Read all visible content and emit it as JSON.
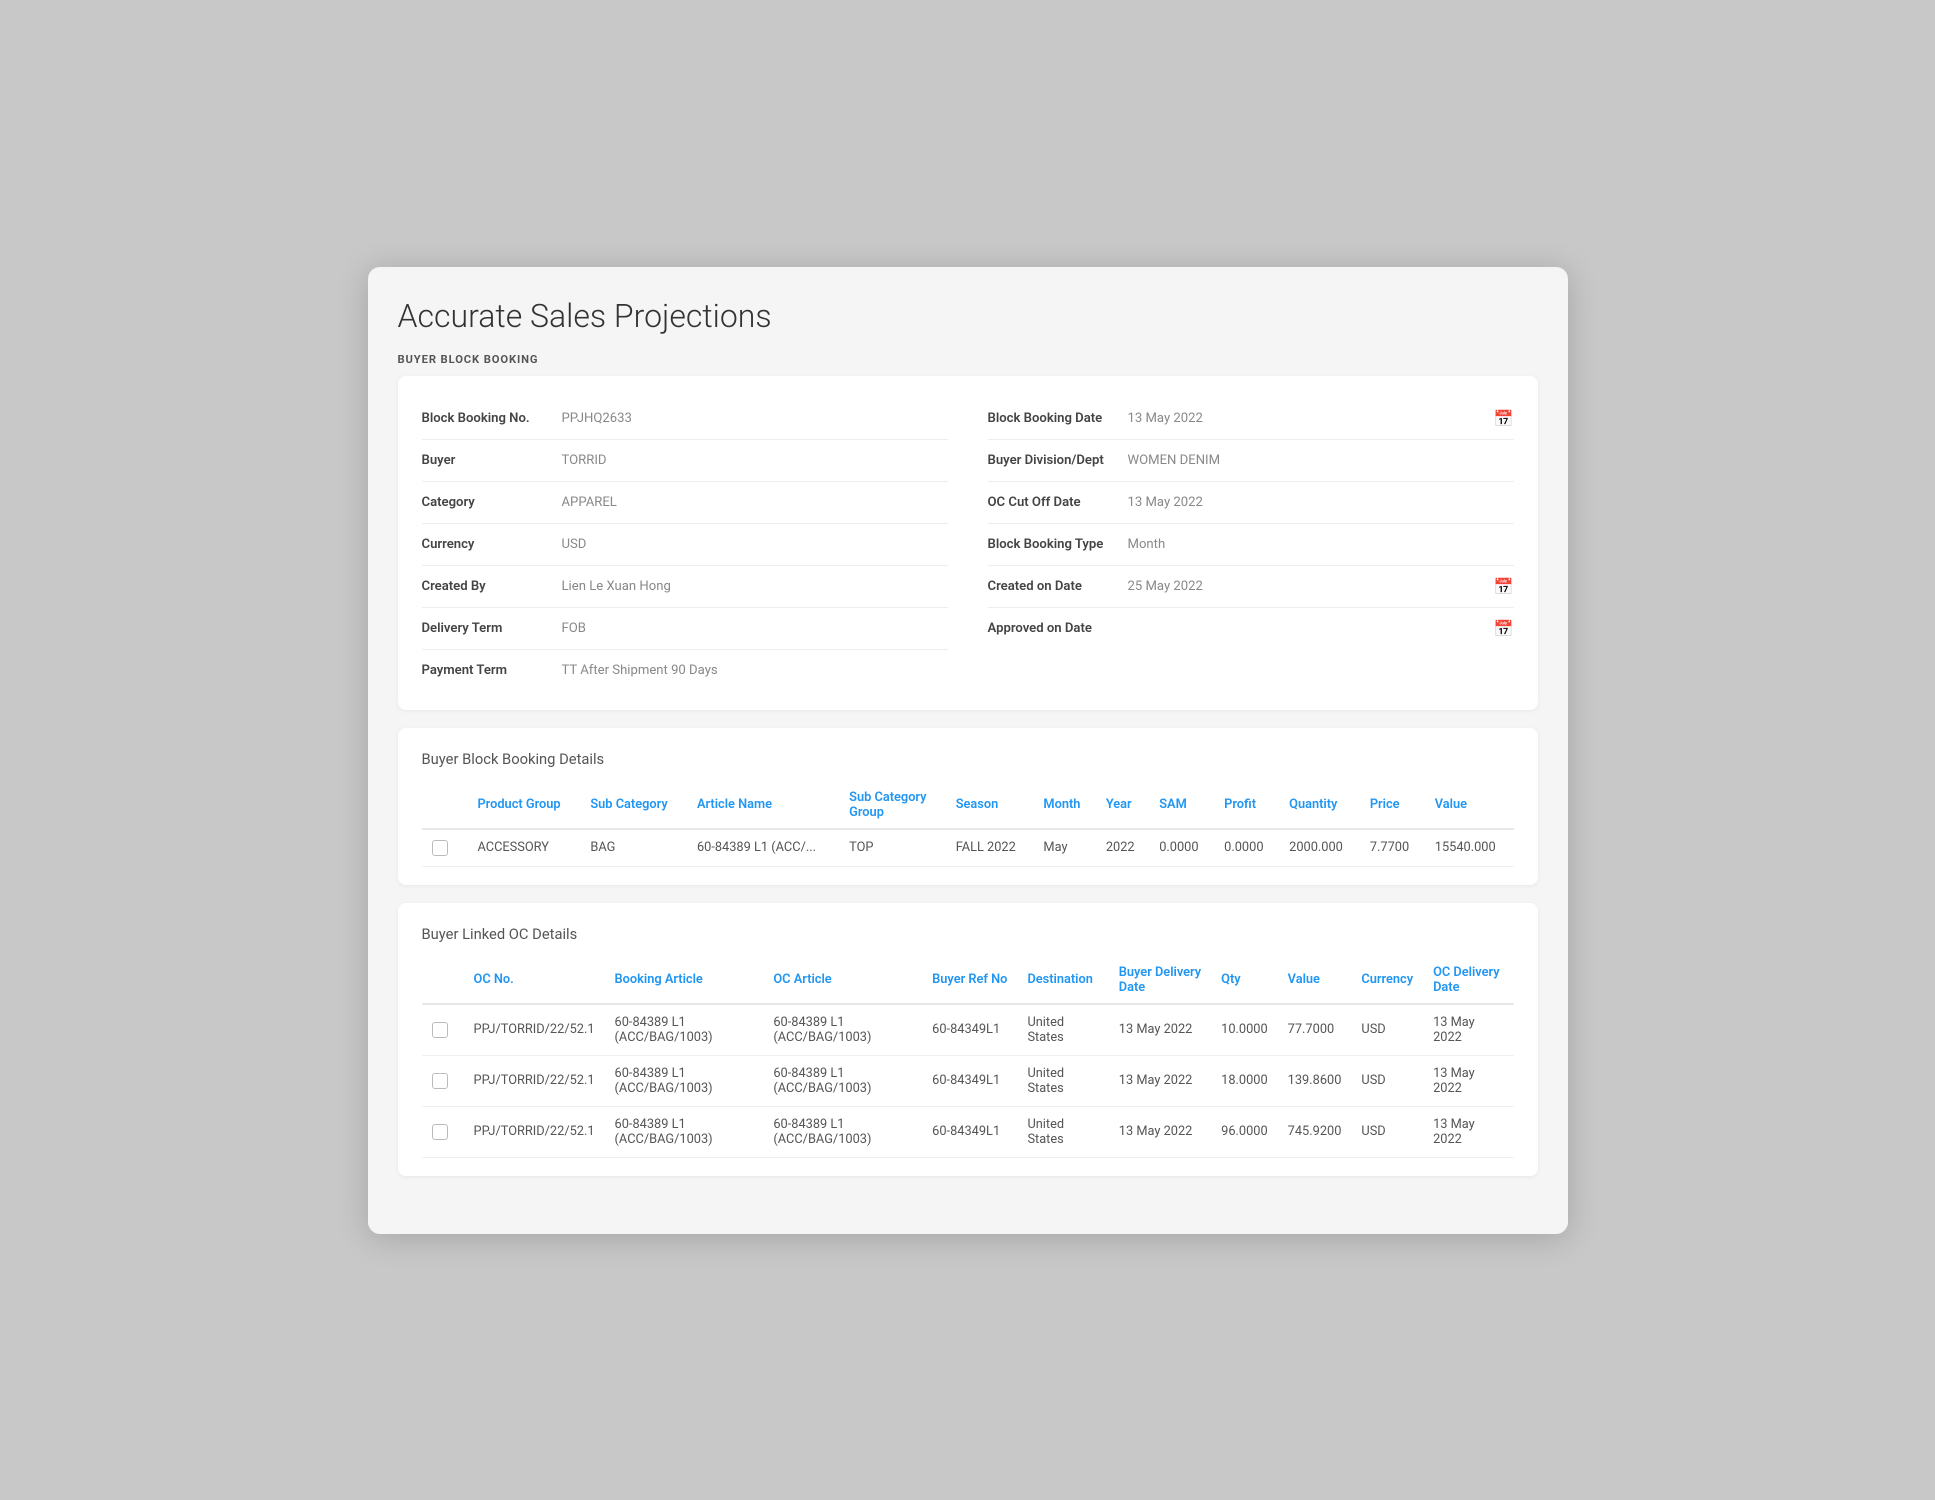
{
  "page": {
    "title": "Accurate Sales Projections",
    "section_label": "BUYER BLOCK BOOKING"
  },
  "form": {
    "left": [
      {
        "label": "Block Booking No.",
        "value": "PPJHQ2633"
      },
      {
        "label": "Buyer",
        "value": "TORRID"
      },
      {
        "label": "Category",
        "value": "APPAREL"
      },
      {
        "label": "Currency",
        "value": "USD"
      },
      {
        "label": "Created By",
        "value": "Lien Le Xuan Hong"
      },
      {
        "label": "Delivery Term",
        "value": "FOB"
      },
      {
        "label": "Payment Term",
        "value": "TT After Shipment 90 Days"
      }
    ],
    "right": [
      {
        "label": "Block Booking Date",
        "value": "13 May 2022",
        "has_icon": true
      },
      {
        "label": "Buyer Division/Dept",
        "value": "WOMEN DENIM",
        "has_icon": false
      },
      {
        "label": "OC Cut Off Date",
        "value": "13 May 2022",
        "has_icon": false
      },
      {
        "label": "Block Booking Type",
        "value": "Month",
        "has_icon": false
      },
      {
        "label": "Created on Date",
        "value": "25 May 2022",
        "has_icon": true
      },
      {
        "label": "Approved on Date",
        "value": "",
        "has_icon": true
      }
    ]
  },
  "details_table": {
    "title": "Buyer Block Booking Details",
    "columns": [
      "Product Group",
      "Sub Category",
      "Article Name",
      "Sub Category Group",
      "Season",
      "Month",
      "Year",
      "SAM",
      "Profit",
      "Quantity",
      "Price",
      "Value"
    ],
    "rows": [
      {
        "product_group": "ACCESSORY",
        "sub_category": "BAG",
        "article_name": "60-84389 L1 (ACC/...",
        "sub_category_group": "TOP",
        "season": "FALL 2022",
        "month": "May",
        "year": "2022",
        "sam": "0.0000",
        "profit": "0.0000",
        "quantity": "2000.000",
        "price": "7.7700",
        "value": "15540.000"
      }
    ]
  },
  "linked_oc_table": {
    "title": "Buyer Linked OC Details",
    "columns": [
      "OC No.",
      "Booking Article",
      "OC Article",
      "Buyer Ref No",
      "Destination",
      "Buyer Delivery Date",
      "Qty",
      "Value",
      "Currency",
      "OC Delivery Date"
    ],
    "rows": [
      {
        "oc_no": "PPJ/TORRID/22/52.1",
        "booking_article": "60-84389 L1 (ACC/BAG/1003)",
        "oc_article": "60-84389 L1 (ACC/BAG/1003)",
        "buyer_ref_no": "60-84349L1",
        "destination": "United States",
        "buyer_delivery_date": "13 May 2022",
        "qty": "10.0000",
        "value": "77.7000",
        "currency": "USD",
        "oc_delivery_date": "13 May 2022"
      },
      {
        "oc_no": "PPJ/TORRID/22/52.1",
        "booking_article": "60-84389 L1 (ACC/BAG/1003)",
        "oc_article": "60-84389 L1 (ACC/BAG/1003)",
        "buyer_ref_no": "60-84349L1",
        "destination": "United States",
        "buyer_delivery_date": "13 May 2022",
        "qty": "18.0000",
        "value": "139.8600",
        "currency": "USD",
        "oc_delivery_date": "13 May 2022"
      },
      {
        "oc_no": "PPJ/TORRID/22/52.1",
        "booking_article": "60-84389 L1 (ACC/BAG/1003)",
        "oc_article": "60-84389 L1 (ACC/BAG/1003)",
        "buyer_ref_no": "60-84349L1",
        "destination": "United States",
        "buyer_delivery_date": "13 May 2022",
        "qty": "96.0000",
        "value": "745.9200",
        "currency": "USD",
        "oc_delivery_date": "13 May 2022"
      }
    ]
  }
}
